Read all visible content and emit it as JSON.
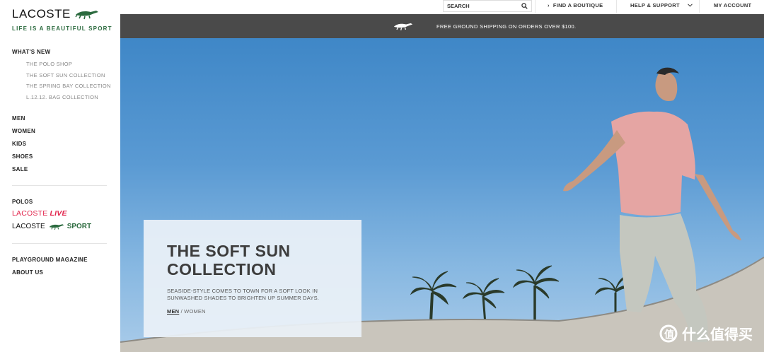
{
  "brand": {
    "name": "LACOSTE",
    "tagline": "LIFE IS A BEAUTIFUL SPORT"
  },
  "sidebar": {
    "whats_new": "WHAT'S NEW",
    "sub_items": [
      "THE POLO SHOP",
      "THE SOFT SUN COLLECTION",
      "THE SPRING BAY COLLECTION",
      "L.12.12. BAG COLLECTION"
    ],
    "main_items": [
      "MEN",
      "WOMEN",
      "KIDS",
      "SHOES",
      "SALE"
    ],
    "polos": "POLOS",
    "live": {
      "prefix": "LACOSTE",
      "suffix": "LIVE"
    },
    "sport": {
      "prefix": "LACOSTE",
      "suffix": "SPORT"
    },
    "bottom_items": [
      "PLAYGROUND MAGAZINE",
      "ABOUT US"
    ]
  },
  "topbar": {
    "search_label": "SEARCH",
    "find_boutique": "FIND A BOUTIQUE",
    "help_support": "HELP & SUPPORT",
    "my_account": "MY ACCOUNT"
  },
  "banner": {
    "text": "FREE GROUND SHIPPING ON ORDERS OVER $100."
  },
  "hero": {
    "title": "THE SOFT SUN COLLECTION",
    "description": "SEASIDE-STYLE COMES TO TOWN FOR A SOFT LOOK IN SUNWASHED SHADES TO BRIGHTEN UP SUMMER DAYS.",
    "link_men": "MEN",
    "link_sep": "/",
    "link_women": "WOMEN"
  },
  "watermark": {
    "text": "什么值得买"
  },
  "colors": {
    "brand_green": "#2b6a3e",
    "live_red": "#e2264d",
    "banner_bg": "#4a4a4a"
  }
}
